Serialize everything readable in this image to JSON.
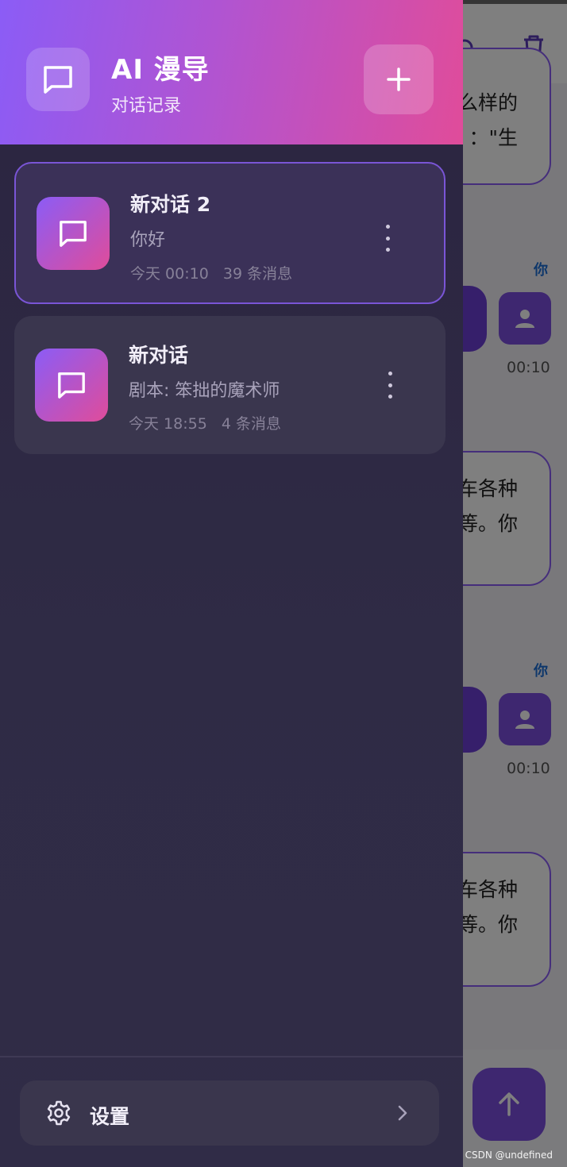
{
  "background_chat": {
    "bubble_1_lines": [
      "么样的",
      "：\"生"
    ],
    "bubble_2_lines": [
      "车各种",
      "等。你"
    ],
    "bubble_3_lines": [
      "车各种",
      "等。你"
    ],
    "user_label": "你",
    "timestamps": [
      "00:10",
      "00:10"
    ]
  },
  "drawer": {
    "header": {
      "title": "AI 漫导",
      "subtitle": "对话记录",
      "icon": "chat-bubble-icon",
      "add_icon": "plus-icon"
    },
    "conversations": [
      {
        "title": "新对话 2",
        "preview": "你好",
        "time": "今天 00:10",
        "count": "39 条消息",
        "active": true
      },
      {
        "title": "新对话",
        "preview": "剧本: 笨拙的魔术师",
        "time": "今天 18:55",
        "count": "4 条消息",
        "active": false
      }
    ],
    "settings": {
      "label": "设置",
      "icon": "gear-icon"
    }
  },
  "watermark": "CSDN @undefined",
  "colors": {
    "header_gradient_start": "#8b5cf6",
    "header_gradient_end": "#e04c9a",
    "drawer_bg": "#2f2b45",
    "active_border": "#7a55d6",
    "accent_purple": "#7c4fe0"
  }
}
